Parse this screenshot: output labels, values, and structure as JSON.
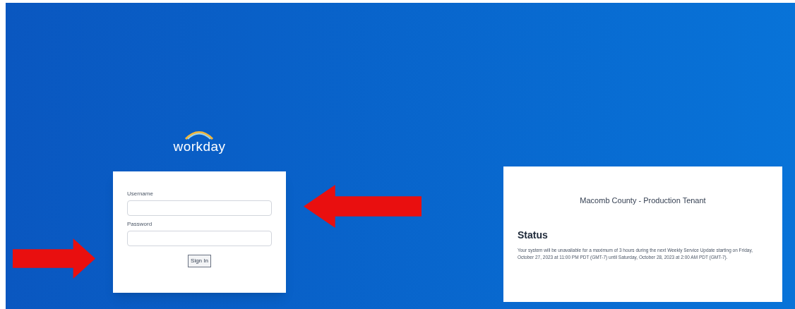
{
  "logo": {
    "text": "workday"
  },
  "login": {
    "fields": [
      {
        "label": "Username"
      },
      {
        "label": "Password"
      }
    ],
    "button": "Sign In"
  },
  "status_card": {
    "tenant": "Macomb County - Production Tenant",
    "heading": "Status",
    "message": "Your system will be unavailable for a maximum of 3 hours during the next Weekly Service Update starting on Friday, October 27, 2023 at 11:00 PM PDT (GMT-7) until Saturday, October 28, 2023 at 2:00 AM PDT (GMT-7)."
  },
  "annotations": [
    {
      "kind": "left-arrow"
    },
    {
      "kind": "right-arrow"
    }
  ]
}
